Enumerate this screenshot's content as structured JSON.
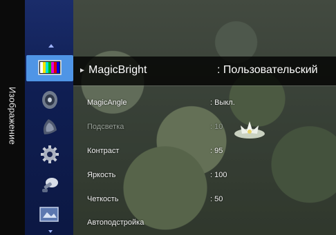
{
  "side_title": "Изображение",
  "icons": [
    {
      "name": "picture-tv-icon",
      "selected": true
    },
    {
      "name": "sound-speaker-icon",
      "selected": false
    },
    {
      "name": "channel-satellite-icon",
      "selected": false
    },
    {
      "name": "settings-gear-icon",
      "selected": false
    },
    {
      "name": "support-icon",
      "selected": false
    },
    {
      "name": "input-source-icon",
      "selected": false
    }
  ],
  "menu": {
    "main": {
      "label": "MagicBright",
      "value": ": Пользовательский"
    },
    "items": [
      {
        "label": "MagicAngle",
        "value": ": Выкл.",
        "dim": false
      },
      {
        "label": "Подсветка",
        "value": ": 10",
        "dim": true
      },
      {
        "label": "Контраст",
        "value": ": 95",
        "dim": false
      },
      {
        "label": "Яркость",
        "value": ": 100",
        "dim": false
      },
      {
        "label": "Четкость",
        "value": ": 50",
        "dim": false
      },
      {
        "label": "Автоподстройка",
        "value": "",
        "dim": false
      }
    ]
  },
  "colors": {
    "selected_icon_bg": "#4f95e6",
    "icon_column": "#1a2c6a"
  }
}
